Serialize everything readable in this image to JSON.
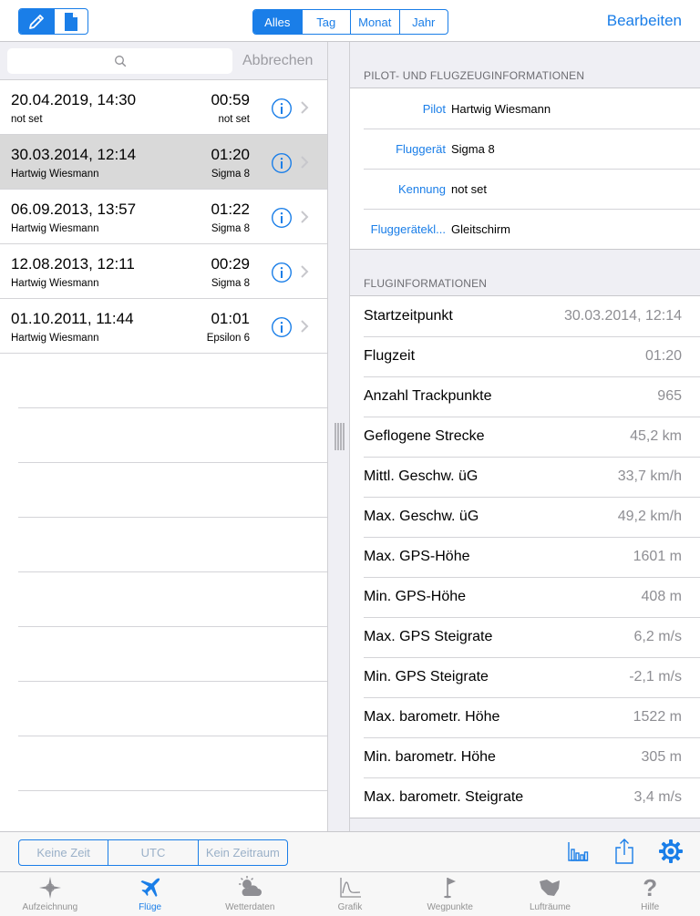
{
  "toolbar": {
    "period_segments": [
      "Alles",
      "Tag",
      "Monat",
      "Jahr"
    ],
    "selected_period": "Alles",
    "edit_label": "Bearbeiten"
  },
  "search": {
    "placeholder": "",
    "cancel_label": "Abbrechen"
  },
  "flights": [
    {
      "date": "20.04.2019, 14:30",
      "duration": "00:59",
      "pilot": "not set",
      "glider": "not set",
      "selected": false
    },
    {
      "date": "30.03.2014, 12:14",
      "duration": "01:20",
      "pilot": "Hartwig Wiesmann",
      "glider": "Sigma 8",
      "selected": true
    },
    {
      "date": "06.09.2013, 13:57",
      "duration": "01:22",
      "pilot": "Hartwig Wiesmann",
      "glider": "Sigma 8",
      "selected": false
    },
    {
      "date": "12.08.2013, 12:11",
      "duration": "00:29",
      "pilot": "Hartwig Wiesmann",
      "glider": "Sigma 8",
      "selected": false
    },
    {
      "date": "01.10.2011, 11:44",
      "duration": "01:01",
      "pilot": "Hartwig Wiesmann",
      "glider": "Epsilon 6",
      "selected": false
    }
  ],
  "detail": {
    "pilot_section": {
      "header": "PILOT- UND FLUGZEUGINFORMATIONEN",
      "rows": [
        {
          "label": "Pilot",
          "value": "Hartwig Wiesmann"
        },
        {
          "label": "Fluggerät",
          "value": "Sigma 8"
        },
        {
          "label": "Kennung",
          "value": "not set"
        },
        {
          "label": "Fluggerätekl...",
          "value": "Gleitschirm"
        }
      ]
    },
    "flight_section": {
      "header": "FLUGINFORMATIONEN",
      "rows": [
        {
          "label": "Startzeitpunkt",
          "value": "30.03.2014, 12:14"
        },
        {
          "label": "Flugzeit",
          "value": "01:20"
        },
        {
          "label": "Anzahl Trackpunkte",
          "value": "965"
        },
        {
          "label": "Geflogene Strecke",
          "value": "45,2 km"
        },
        {
          "label": "Mittl. Geschw. üG",
          "value": "33,7 km/h"
        },
        {
          "label": "Max. Geschw. üG",
          "value": "49,2 km/h"
        },
        {
          "label": "Max. GPS-Höhe",
          "value": "1601 m"
        },
        {
          "label": "Min. GPS-Höhe",
          "value": "408 m"
        },
        {
          "label": "Max. GPS Steigrate",
          "value": "6,2 m/s"
        },
        {
          "label": "Min. GPS Steigrate",
          "value": "-2,1 m/s"
        },
        {
          "label": "Max. barometr. Höhe",
          "value": "1522 m"
        },
        {
          "label": "Min. barometr. Höhe",
          "value": "305 m"
        },
        {
          "label": "Max. barometr. Steigrate",
          "value": "3,4 m/s"
        }
      ]
    }
  },
  "time_filter": [
    "Keine Zeit",
    "UTC",
    "Kein Zeitraum"
  ],
  "tabs": [
    {
      "label": "Aufzeichnung",
      "icon": "compass-star-icon"
    },
    {
      "label": "Flüge",
      "icon": "airplane-icon",
      "selected": true
    },
    {
      "label": "Wetterdaten",
      "icon": "weather-icon"
    },
    {
      "label": "Grafik",
      "icon": "graph-icon"
    },
    {
      "label": "Wegpunkte",
      "icon": "flag-icon"
    },
    {
      "label": "Lufträume",
      "icon": "airspace-icon"
    },
    {
      "label": "Hilfe",
      "icon": "help-icon"
    }
  ],
  "colors": {
    "accent": "#1a7ee8",
    "selected_row": "#d9d9d9",
    "secondary_text": "#8e8e93"
  }
}
